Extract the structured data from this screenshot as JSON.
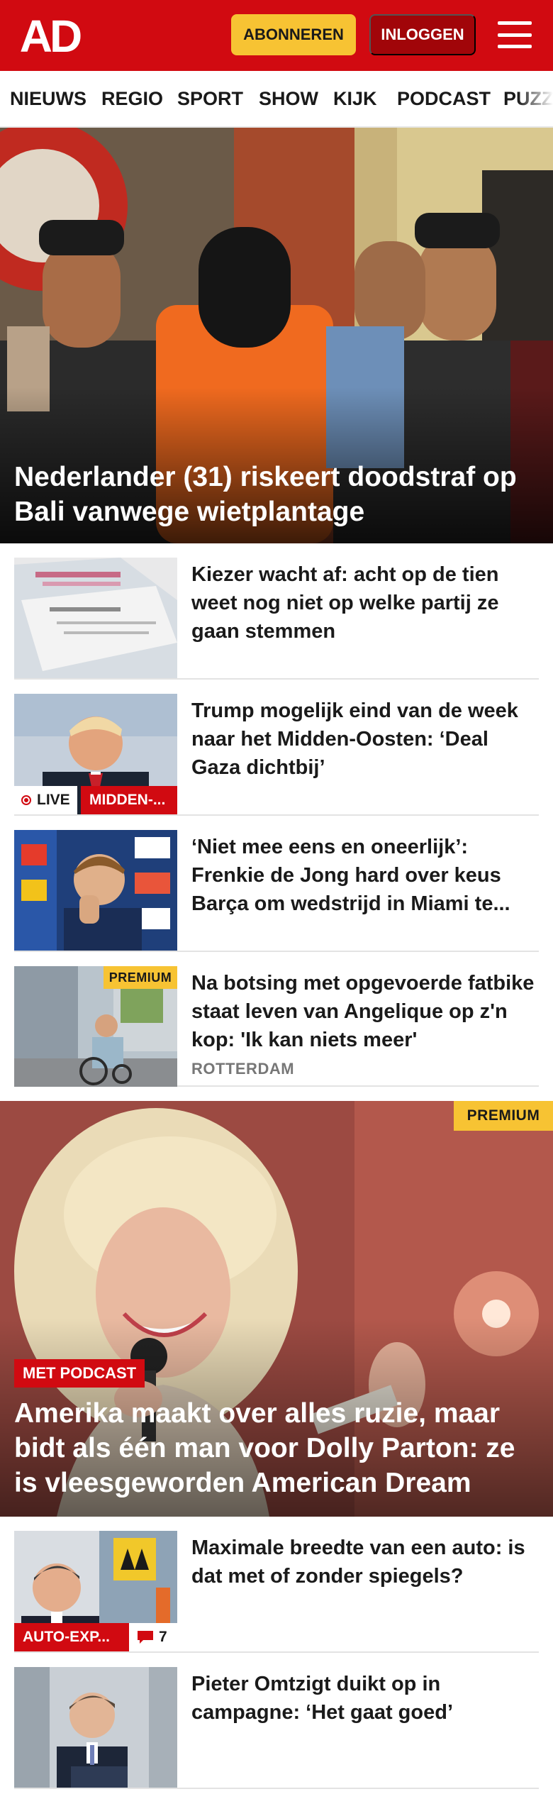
{
  "header": {
    "logo_text": "AD",
    "subscribe_label": "ABONNEREN",
    "login_label": "INLOGGEN",
    "menu_icon": "hamburger-menu-icon",
    "brand_color": "#d10a11",
    "accent_color": "#f7c333"
  },
  "nav": {
    "items": [
      {
        "label": "NIEUWS"
      },
      {
        "label": "REGIO"
      },
      {
        "label": "SPORT"
      },
      {
        "label": "SHOW"
      },
      {
        "label": "KIJK"
      },
      {
        "label": "PODCAST"
      },
      {
        "label": "PUZZ"
      }
    ]
  },
  "hero": {
    "title": "Nederlander (31) riskeert doodstraf op Bali vanwege wietplantage"
  },
  "articles": [
    {
      "title": "Kiezer wacht af: acht op de tien weet nog niet op welke partij ze gaan stemmen"
    },
    {
      "title": "Trump mogelijk eind van de week naar het Midden-Oosten: ‘Deal Gaza dichtbij’",
      "live_label": "LIVE",
      "category_label": "MIDDEN-..."
    },
    {
      "title": "‘Niet mee eens en oneerlijk’: Frenkie de Jong hard over keus Barça om wedstrijd in Miami te..."
    },
    {
      "title": "Na botsing met opgevoerde fatbike staat leven van Angelique op z'n kop: 'Ik kan niets meer'",
      "premium_label": "PREMIUM",
      "location": "ROTTERDAM"
    }
  ],
  "feature": {
    "premium_label": "PREMIUM",
    "badge_label": "MET PODCAST",
    "title": "Amerika maakt over alles ruzie, maar bidt als één man voor Dolly Parton: ze is vleesgeworden American Dream"
  },
  "articles2": [
    {
      "title": "Maximale breedte van een auto: is dat met of zonder spiegels?",
      "category_label": "AUTO-EXP...",
      "comment_count": "7",
      "comment_icon": "comment-bubble-icon"
    },
    {
      "title": "Pieter Omtzigt duikt op in campagne: ‘Het gaat goed’"
    }
  ]
}
